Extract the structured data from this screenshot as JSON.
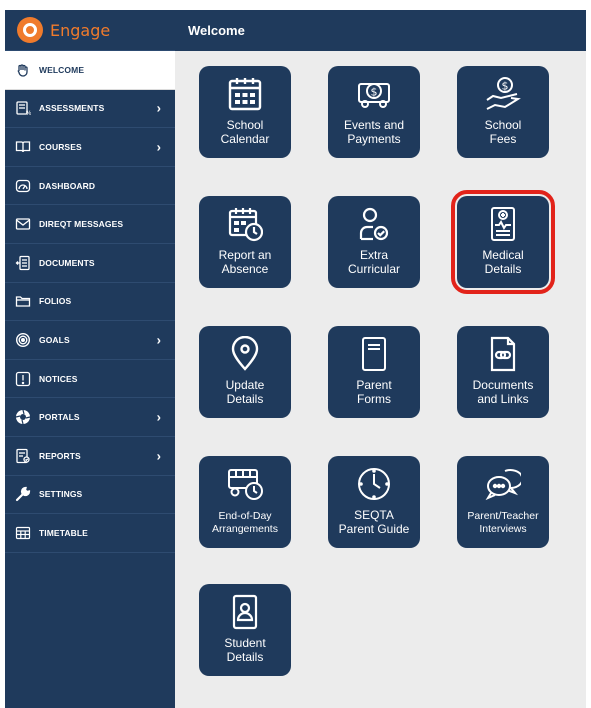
{
  "brand": {
    "name": "Engage"
  },
  "header": {
    "title": "Welcome"
  },
  "sidebar": {
    "items": [
      {
        "label": "WELCOME",
        "icon": "hand-wave-icon"
      },
      {
        "label": "ASSESSMENTS",
        "icon": "assessments-icon"
      },
      {
        "label": "COURSES",
        "icon": "book-open-icon"
      },
      {
        "label": "DASHBOARD",
        "icon": "dashboard-icon"
      },
      {
        "label": "DIREQT MESSAGES",
        "icon": "envelope-icon"
      },
      {
        "label": "DOCUMENTS",
        "icon": "documents-icon"
      },
      {
        "label": "FOLIOS",
        "icon": "folder-icon"
      },
      {
        "label": "GOALS",
        "icon": "target-icon"
      },
      {
        "label": "NOTICES",
        "icon": "notice-icon"
      },
      {
        "label": "PORTALS",
        "icon": "portal-icon"
      },
      {
        "label": "REPORTS",
        "icon": "reports-icon"
      },
      {
        "label": "SETTINGS",
        "icon": "wrench-icon"
      },
      {
        "label": "TIMETABLE",
        "icon": "timetable-icon"
      }
    ]
  },
  "tiles": [
    {
      "label": "School\nCalendar",
      "icon": "calendar-icon"
    },
    {
      "label": "Events and\nPayments",
      "icon": "bus-money-icon"
    },
    {
      "label": "School\nFees",
      "icon": "hand-money-icon"
    },
    {
      "label": "Report an\nAbsence",
      "icon": "calendar-clock-icon"
    },
    {
      "label": "Extra\nCurricular",
      "icon": "person-check-icon"
    },
    {
      "label": "Medical\nDetails",
      "icon": "medical-document-icon"
    },
    {
      "label": "Update\nDetails",
      "icon": "location-pin-icon"
    },
    {
      "label": "Parent\nForms",
      "icon": "form-icon"
    },
    {
      "label": "Documents\nand Links",
      "icon": "document-link-icon"
    },
    {
      "label": "End-of-Day\nArrangements",
      "icon": "bus-clock-icon"
    },
    {
      "label": "SEQTA\nParent Guide",
      "icon": "clock-icon"
    },
    {
      "label": "Parent/Teacher\nInterviews",
      "icon": "chat-bubbles-icon"
    },
    {
      "label": "Student\nDetails",
      "icon": "id-card-icon"
    }
  ],
  "colors": {
    "primary": "#1f3a5c",
    "brand": "#f07b2c",
    "background": "#ececec",
    "highlight": "#e2231a"
  }
}
